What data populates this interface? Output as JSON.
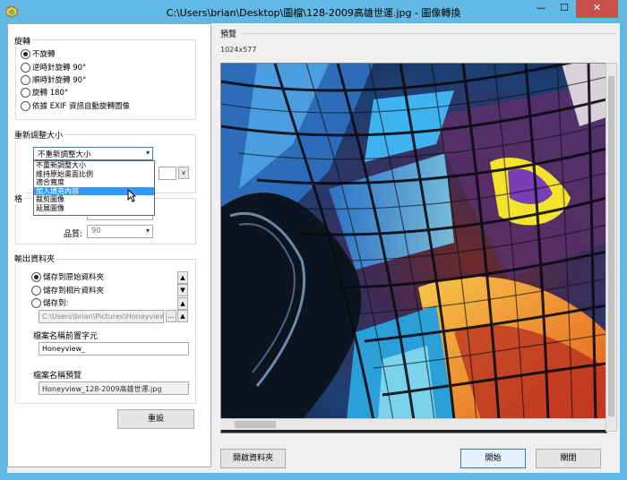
{
  "window": {
    "title": "C:\\Users\\brian\\Desktop\\圖檔\\128-2009高雄世運.jpg - 圖像轉換",
    "minimize_glyph": "—",
    "maximize_glyph": "☐",
    "close_glyph": "✕",
    "close_color": "#c7504b",
    "titlebar_color": "#62b9e4"
  },
  "rotate": {
    "title": "旋轉",
    "options": [
      {
        "label": "不旋轉",
        "selected": true
      },
      {
        "label": "逆時針旋轉 90°",
        "selected": false
      },
      {
        "label": "順時針旋轉 90°",
        "selected": false
      },
      {
        "label": "旋轉 180°",
        "selected": false
      },
      {
        "label": "依據 EXIF 資訊自動旋轉圖像",
        "selected": false
      }
    ]
  },
  "resize": {
    "title": "重新調整大小",
    "selected": "不重新調整大小",
    "dropdown_options": [
      {
        "label": "不重新調整大小",
        "highlighted": false
      },
      {
        "label": "維持原始畫面比例",
        "highlighted": false
      },
      {
        "label": "適合寬度",
        "highlighted": false
      },
      {
        "label": "加入填充內容",
        "highlighted": true
      },
      {
        "label": "裁剪圖像",
        "highlighted": false
      },
      {
        "label": "延展圖像",
        "highlighted": false
      }
    ],
    "unit_arrow": "v"
  },
  "format": {
    "title_partial": "格",
    "quality_label": "品質:",
    "quality_value": "90"
  },
  "output": {
    "title": "輸出資料夾",
    "options": [
      {
        "label": "儲存到原始資料夾",
        "selected": true
      },
      {
        "label": "儲存到相片資料夾",
        "selected": false
      },
      {
        "label": "儲存到:",
        "selected": false
      }
    ],
    "path": "C:\\Users\\brian\\Pictures\\Honeyview",
    "browse_label": "...",
    "prefix_label": "檔案名稱前置字元",
    "prefix_value": "Honeyview_",
    "filename_preview_label": "檔案名稱預覽",
    "filename_preview_value": "Honeyview_128-2009高雄世運.jpg"
  },
  "reset_label": "重設",
  "preview": {
    "header": "預覽",
    "size": "1024x577"
  },
  "buttons": {
    "open_folder": "開啟資料夾",
    "start": "開始",
    "close": "關閉"
  }
}
